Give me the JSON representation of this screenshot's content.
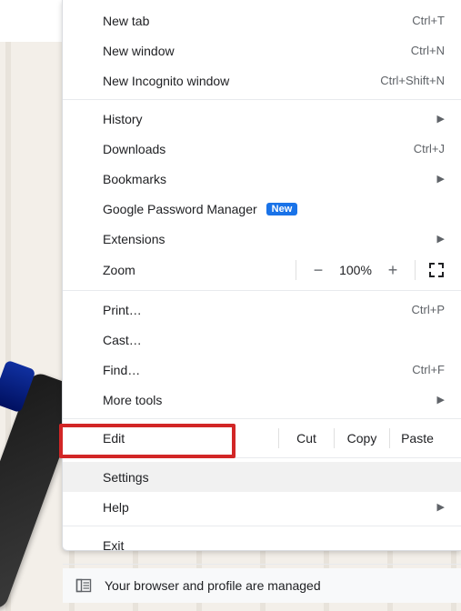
{
  "items": {
    "new_tab": {
      "label": "New tab",
      "shortcut": "Ctrl+T"
    },
    "new_window": {
      "label": "New window",
      "shortcut": "Ctrl+N"
    },
    "incognito": {
      "label": "New Incognito window",
      "shortcut": "Ctrl+Shift+N"
    },
    "history": {
      "label": "History"
    },
    "downloads": {
      "label": "Downloads",
      "shortcut": "Ctrl+J"
    },
    "bookmarks": {
      "label": "Bookmarks"
    },
    "password_mgr": {
      "label": "Google Password Manager",
      "badge": "New"
    },
    "extensions": {
      "label": "Extensions"
    },
    "zoom": {
      "label": "Zoom",
      "minus": "−",
      "value": "100%",
      "plus": "+"
    },
    "print": {
      "label": "Print…",
      "shortcut": "Ctrl+P"
    },
    "cast": {
      "label": "Cast…"
    },
    "find": {
      "label": "Find…",
      "shortcut": "Ctrl+F"
    },
    "more_tools": {
      "label": "More tools"
    },
    "edit": {
      "label": "Edit",
      "cut": "Cut",
      "copy": "Copy",
      "paste": "Paste"
    },
    "settings": {
      "label": "Settings"
    },
    "help": {
      "label": "Help"
    },
    "exit": {
      "label": "Exit"
    }
  },
  "managed_text": "Your browser and profile are managed"
}
